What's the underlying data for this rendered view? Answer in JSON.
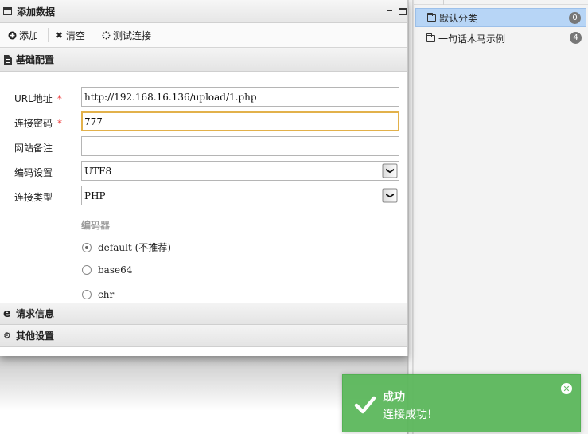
{
  "dialog": {
    "title": "添加数据",
    "toolbar": {
      "add_label": "添加",
      "clear_label": "清空",
      "test_label": "测试连接"
    },
    "sections": {
      "basic": "基础配置",
      "request": "请求信息",
      "other": "其他设置"
    },
    "form": {
      "url_label": "URL地址",
      "url_value": "http://192.168.16.136/upload/1.php",
      "password_label": "连接密码",
      "password_value": "777",
      "note_label": "网站备注",
      "note_value": "",
      "encoding_label": "编码设置",
      "encoding_value": "UTF8",
      "type_label": "连接类型",
      "type_value": "PHP",
      "required_mark": "*",
      "encoder_title": "编码器",
      "encoders": [
        {
          "label": "default (不推荐)",
          "selected": true
        },
        {
          "label": "base64",
          "selected": false
        },
        {
          "label": "chr",
          "selected": false
        }
      ]
    }
  },
  "categories": [
    {
      "label": "默认分类",
      "count": "0",
      "active": true
    },
    {
      "label": "一句话木马示例",
      "count": "4",
      "active": false
    }
  ],
  "toast": {
    "title": "成功",
    "message": "连接成功!",
    "color": "#5cb85c"
  },
  "icons": {
    "window": "window-icon",
    "add": "plus-circle-icon",
    "clear": "x-icon",
    "test": "spinner-icon",
    "basic": "file-icon",
    "request": "ie-icon",
    "other": "gears-icon",
    "folder": "folder-icon",
    "success": "check-icon",
    "close": "close-icon"
  }
}
